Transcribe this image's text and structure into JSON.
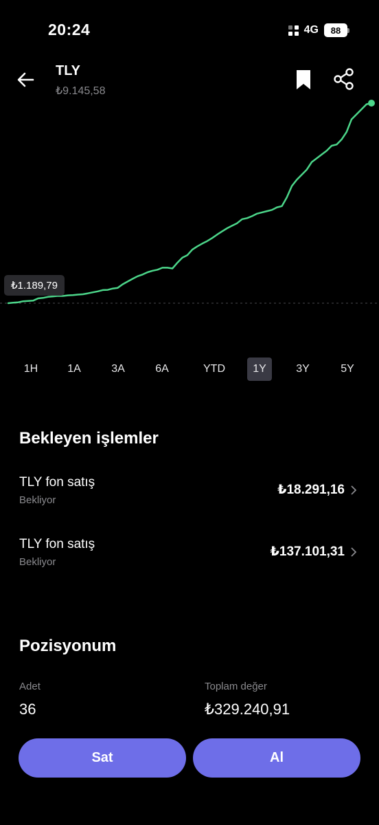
{
  "status": {
    "time": "20:24",
    "network": "4G",
    "battery": "88"
  },
  "header": {
    "title": "TLY",
    "price": "₺9.145,58"
  },
  "icons": {
    "back": "arrow-left-icon",
    "bookmark": "bookmark-icon",
    "share": "share-icon"
  },
  "chart_data": {
    "type": "line",
    "start_label": "₺1.189,79",
    "color": "#4cd68a",
    "values": [
      1189,
      1210,
      1225,
      1265,
      1280,
      1290,
      1380,
      1400,
      1440,
      1460,
      1480,
      1475,
      1500,
      1510,
      1530,
      1545,
      1580,
      1620,
      1660,
      1710,
      1720,
      1770,
      1800,
      1940,
      2050,
      2160,
      2260,
      2330,
      2420,
      2480,
      2520,
      2600,
      2600,
      2570,
      2800,
      3000,
      3100,
      3320,
      3450,
      3560,
      3660,
      3780,
      3920,
      4050,
      4170,
      4270,
      4370,
      4530,
      4570,
      4650,
      4750,
      4800,
      4850,
      4900,
      5000,
      5050,
      5400,
      5850,
      6100,
      6300,
      6500,
      6800,
      6950,
      7100,
      7250,
      7450,
      7500,
      7700,
      8000,
      8500,
      8700,
      8900,
      9100,
      9145
    ]
  },
  "ranges": {
    "items": [
      {
        "label": "1H"
      },
      {
        "label": "1A"
      },
      {
        "label": "3A"
      },
      {
        "label": "6A"
      },
      {
        "label": "YTD"
      },
      {
        "label": "1Y"
      },
      {
        "label": "3Y"
      },
      {
        "label": "5Y"
      }
    ],
    "active": "1Y"
  },
  "pending": {
    "title": "Bekleyen işlemler",
    "items": [
      {
        "name": "TLY fon satış",
        "status": "Bekliyor",
        "amount": "₺18.291,16"
      },
      {
        "name": "TLY fon satış",
        "status": "Bekliyor",
        "amount": "₺137.101,31"
      }
    ]
  },
  "position": {
    "title": "Pozisyonum",
    "quantity_label": "Adet",
    "quantity": "36",
    "total_label": "Toplam değer",
    "total": "₺329.240,91"
  },
  "actions": {
    "sell": "Sat",
    "buy": "Al",
    "color": "#6e6ee8"
  }
}
